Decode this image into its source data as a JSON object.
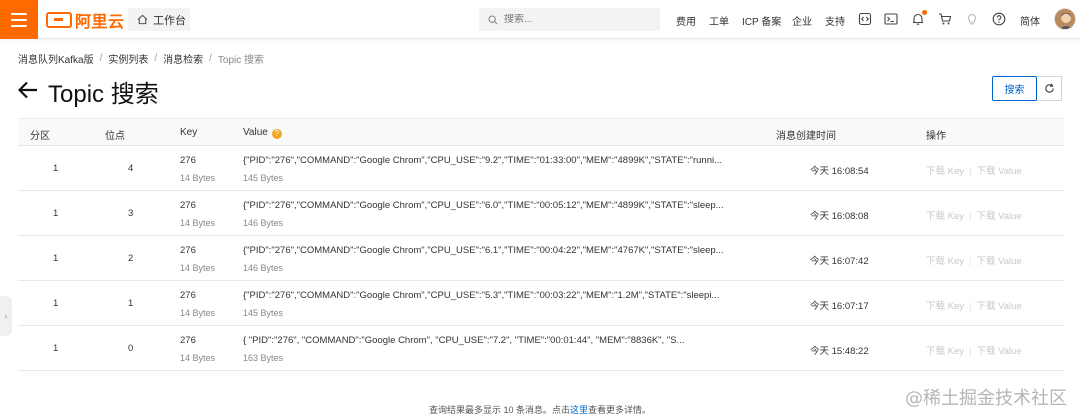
{
  "brand": {
    "logo_text": "阿里云",
    "accent": "#ff6a00"
  },
  "topbar": {
    "workbench_label": "工作台",
    "search_placeholder": "搜索...",
    "links": [
      "费用",
      "工单",
      "ICP 备案",
      "企业",
      "支持"
    ],
    "lang_label": "简体",
    "icons": [
      "code-icon",
      "terminal-icon",
      "bell-icon",
      "cart-icon",
      "bulb-icon",
      "help-icon"
    ]
  },
  "breadcrumb": [
    "消息队列Kafka版",
    "实例列表",
    "消息检索",
    "Topic 搜索"
  ],
  "page": {
    "title": "Topic 搜索",
    "search_button": "搜索"
  },
  "table": {
    "headers": {
      "partition": "分区",
      "offset": "位点",
      "key": "Key",
      "value": "Value",
      "created": "消息创建时间",
      "ops": "操作"
    },
    "help_glyph": "?",
    "rows": [
      {
        "partition": "1",
        "offset": "4",
        "key": "276",
        "key_size": "14 Bytes",
        "value": "{\"PID\":\"276\",\"COMMAND\":\"Google Chrom\",\"CPU_USE\":\"9.2\",\"TIME\":\"01:33:00\",\"MEM\":\"4899K\",\"STATE\":\"runni...",
        "value_size": "145 Bytes",
        "created": "今天 16:08:54",
        "download_key": "下载 Key",
        "download_value": "下载 Value"
      },
      {
        "partition": "1",
        "offset": "3",
        "key": "276",
        "key_size": "14 Bytes",
        "value": "{\"PID\":\"276\",\"COMMAND\":\"Google Chrom\",\"CPU_USE\":\"6.0\",\"TIME\":\"00:05:12\",\"MEM\":\"4899K\",\"STATE\":\"sleep...",
        "value_size": "146 Bytes",
        "created": "今天 16:08:08",
        "download_key": "下载 Key",
        "download_value": "下载 Value"
      },
      {
        "partition": "1",
        "offset": "2",
        "key": "276",
        "key_size": "14 Bytes",
        "value": "{\"PID\":\"276\",\"COMMAND\":\"Google Chrom\",\"CPU_USE\":\"6.1\",\"TIME\":\"00:04:22\",\"MEM\":\"4767K\",\"STATE\":\"sleep...",
        "value_size": "146 Bytes",
        "created": "今天 16:07:42",
        "download_key": "下载 Key",
        "download_value": "下载 Value"
      },
      {
        "partition": "1",
        "offset": "1",
        "key": "276",
        "key_size": "14 Bytes",
        "value": "{\"PID\":\"276\",\"COMMAND\":\"Google Chrom\",\"CPU_USE\":\"5.3\",\"TIME\":\"00:03:22\",\"MEM\":\"1.2M\",\"STATE\":\"sleepi...",
        "value_size": "145 Bytes",
        "created": "今天 16:07:17",
        "download_key": "下载 Key",
        "download_value": "下载 Value"
      },
      {
        "partition": "1",
        "offset": "0",
        "key": "276",
        "key_size": "14 Bytes",
        "value": "{ \"PID\":\"276\", \"COMMAND\":\"Google Chrom\", \"CPU_USE\":\"7.2\", \"TIME\":\"00:01:44\", \"MEM\":\"8836K\", \"S...",
        "value_size": "163 Bytes",
        "created": "今天 15:48:22",
        "download_key": "下载 Key",
        "download_value": "下载 Value"
      }
    ]
  },
  "footer": {
    "before": "查询结果最多显示 10 条消息。点击",
    "link": "这里",
    "after": "查看更多详情。"
  },
  "watermark": "@稀土掘金技术社区",
  "side_tab_glyph": "›"
}
